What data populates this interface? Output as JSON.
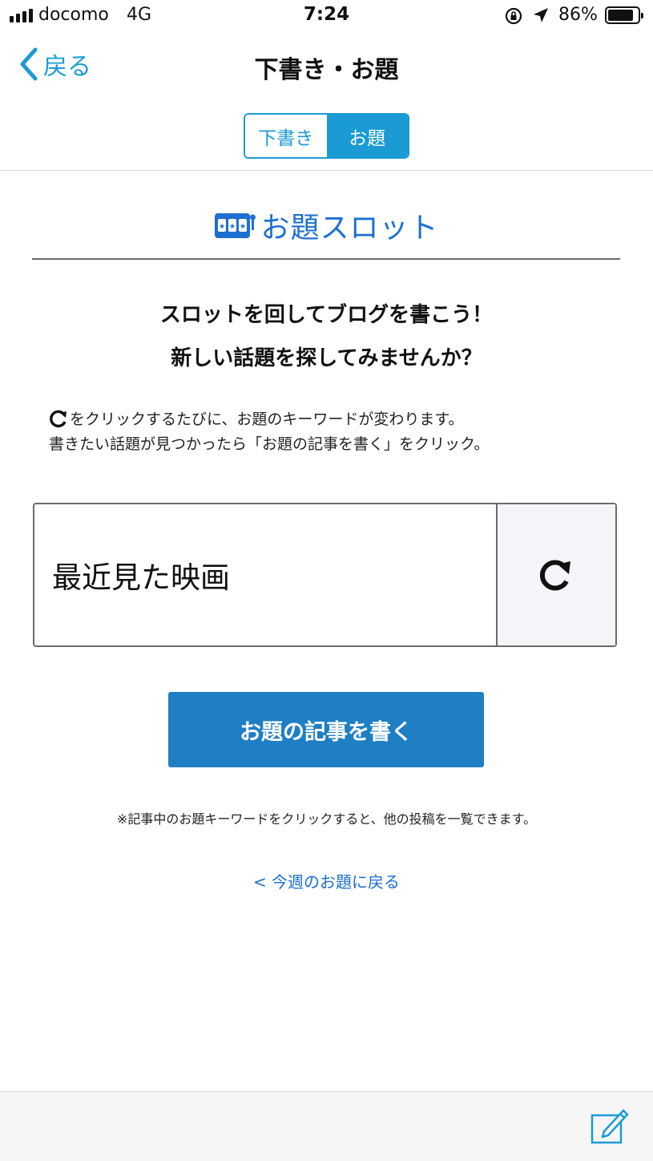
{
  "status_bar": {
    "carrier": "docomo",
    "network": "4G",
    "time": "7:24",
    "battery_percent": "86%",
    "battery_level": 0.86
  },
  "nav": {
    "back_label": "戻る",
    "title": "下書き・お題"
  },
  "segmented": {
    "drafts_label": "下書き",
    "topics_label": "お題",
    "selected": "お題"
  },
  "slot": {
    "title": "お題スロット",
    "heading_line1": "スロットを回してブログを書こう！",
    "heading_line2": "新しい話題を探してみませんか？",
    "desc_line1": "をクリックするたびに、お題のキーワードが変わります。",
    "desc_line2": "書きたい話題が見つかったら「お題の記事を書く」をクリック。",
    "keyword": "最近見た映画",
    "write_button_label": "お題の記事を書く",
    "note": "※記事中のお題キーワードをクリックすると、他の投稿を一覧できます。",
    "back_link": "< 今週のお題に戻る"
  },
  "colors": {
    "accent": "#1a9bd4",
    "link_blue": "#1d6fd1",
    "button_blue": "#1e7fc4"
  },
  "icons": {
    "back": "chevron-left-icon",
    "slot": "slot-machine-icon",
    "refresh": "refresh-icon",
    "compose": "compose-icon"
  }
}
